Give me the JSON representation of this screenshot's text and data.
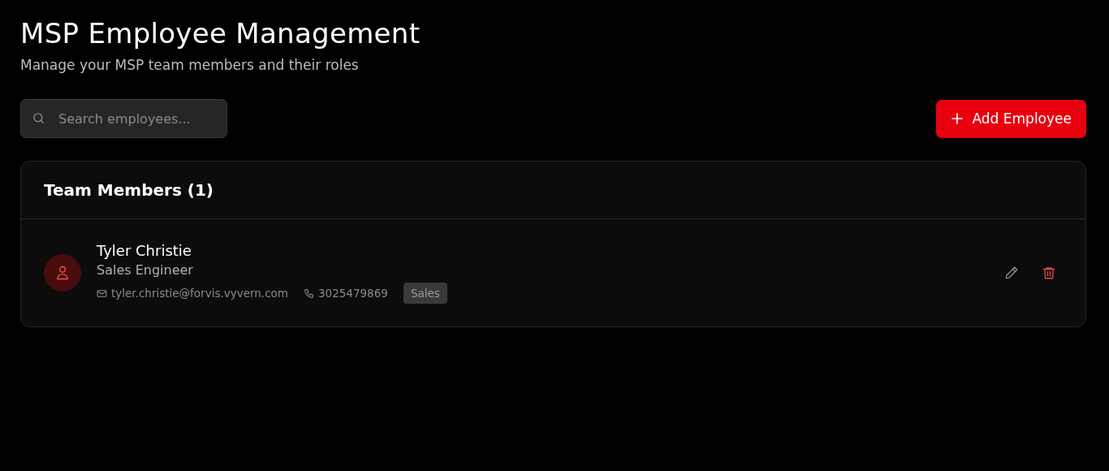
{
  "header": {
    "title": "MSP Employee Management",
    "subtitle": "Manage your MSP team members and their roles"
  },
  "search": {
    "placeholder": "Search employees..."
  },
  "add_button": {
    "label": "Add Employee"
  },
  "team": {
    "title": "Team Members (1)",
    "members": [
      {
        "name": "Tyler Christie",
        "role": "Sales Engineer",
        "email": "tyler.christie@forvis.vyvern.com",
        "phone": "3025479869",
        "department": "Sales"
      }
    ]
  }
}
